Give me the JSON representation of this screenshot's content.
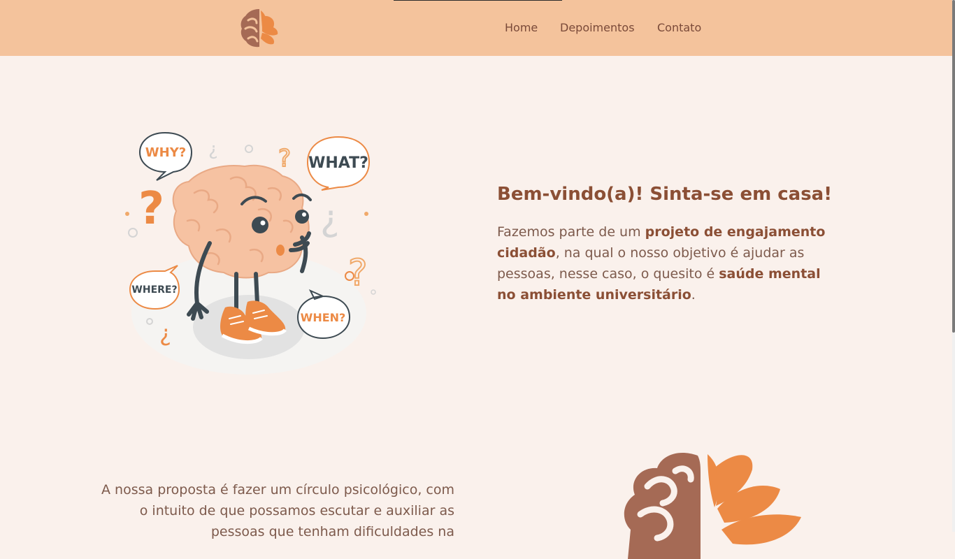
{
  "nav": {
    "items": [
      {
        "label": "Home"
      },
      {
        "label": "Depoimentos"
      },
      {
        "label": "Contato"
      }
    ]
  },
  "hero": {
    "bubbles": {
      "why": "WHY?",
      "what": "WHAT?",
      "where": "WHERE?",
      "when": "WHEN?"
    },
    "title": "Bem-vindo(a)! Sinta-se em casa!",
    "text_1": "Fazemos parte de um ",
    "text_bold_1": "projeto de engajamento cidadão",
    "text_2": ", na qual o nosso objetivo é ajudar as pessoas, nesse caso, o quesito é ",
    "text_bold_2": "saúde mental no ambiente universitário",
    "text_3": "."
  },
  "proposal": {
    "text": "A nossa proposta é fazer um círculo psicológico, com o intuito de que possamos escutar e auxiliar as pessoas que tenham dificuldades na"
  },
  "colors": {
    "header_bg": "#f4c39c",
    "page_bg": "#faf1ec",
    "brand_brown": "#8b4f35",
    "brain_brown": "#a56a55",
    "lotus_orange": "#ec8a45"
  },
  "icons": {
    "logo": "brain-lotus-logo",
    "illustration": "confused-brain-illustration"
  }
}
